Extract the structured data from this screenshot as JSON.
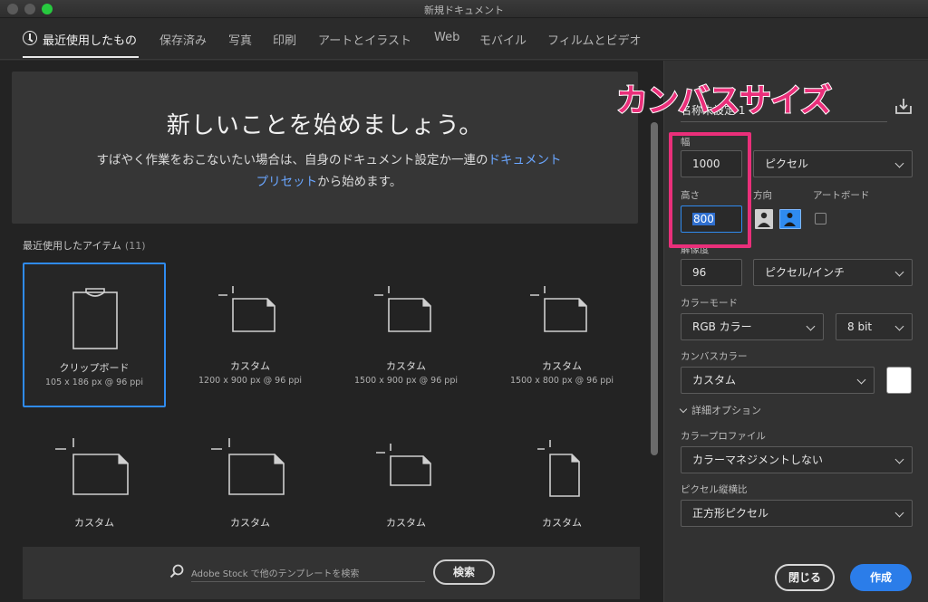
{
  "window": {
    "title": "新規ドキュメント"
  },
  "tabs": [
    {
      "label": "最近使用したもの",
      "active": true
    },
    {
      "label": "保存済み"
    },
    {
      "label": "写真"
    },
    {
      "label": "印刷"
    },
    {
      "label": "アートとイラスト"
    },
    {
      "label": "Web"
    },
    {
      "label": "モバイル"
    },
    {
      "label": "フィルムとビデオ"
    }
  ],
  "hero": {
    "close": "✕",
    "title": "新しいことを始めましょう。",
    "desc_before": "すばやく作業をおこないたい場合は、自身のドキュメント設定か一連の",
    "desc_link": "ドキュメントプリセット",
    "desc_after": "から始めます。"
  },
  "recent": {
    "label": "最近使用したアイテム",
    "count": "(11)",
    "items": [
      {
        "name": "クリップボード",
        "size": "105 x 186 px @ 96 ppi",
        "icon": "clipboard-icon"
      },
      {
        "name": "カスタム",
        "size": "1200 x 900 px @ 96 ppi",
        "icon": "custom-document-icon"
      },
      {
        "name": "カスタム",
        "size": "1500 x 900 px @ 96 ppi",
        "icon": "custom-document-icon"
      },
      {
        "name": "カスタム",
        "size": "1500 x 800 px @ 96 ppi",
        "icon": "custom-document-icon"
      },
      {
        "name": "カスタム",
        "size": "",
        "icon": "custom-document-icon"
      },
      {
        "name": "カスタム",
        "size": "",
        "icon": "custom-document-icon"
      },
      {
        "name": "カスタム",
        "size": "",
        "icon": "custom-document-icon"
      },
      {
        "name": "カスタム",
        "size": "",
        "icon": "custom-document-icon"
      }
    ]
  },
  "search": {
    "placeholder": "Adobe Stock で他のテンプレートを検索",
    "button": "検索"
  },
  "preset": {
    "name": "名称未設定 1",
    "width_label": "幅",
    "width_value": "1000",
    "width_unit": "ピクセル",
    "height_label": "高さ",
    "height_value": "800",
    "orientation_label": "方向",
    "artboard_label": "アートボード",
    "resolution_label": "解像度",
    "resolution_value": "96",
    "resolution_unit": "ピクセル/インチ",
    "color_mode_label": "カラーモード",
    "color_mode_value": "RGB カラー",
    "bit_depth": "8 bit",
    "canvas_color_label": "カンバスカラー",
    "canvas_color_value": "カスタム",
    "canvas_color_hex": "#ffffff",
    "advanced_label": "詳細オプション",
    "color_profile_label": "カラープロファイル",
    "color_profile_value": "カラーマネジメントしない",
    "pixel_aspect_label": "ピクセル縦横比",
    "pixel_aspect_value": "正方形ピクセル"
  },
  "actions": {
    "close": "閉じる",
    "create": "作成"
  },
  "annotation": {
    "label": "カンバスサイズ",
    "color": "#ea2f7a"
  },
  "colors": {
    "accent": "#2f8bf0",
    "create_button": "#2b7de9"
  }
}
